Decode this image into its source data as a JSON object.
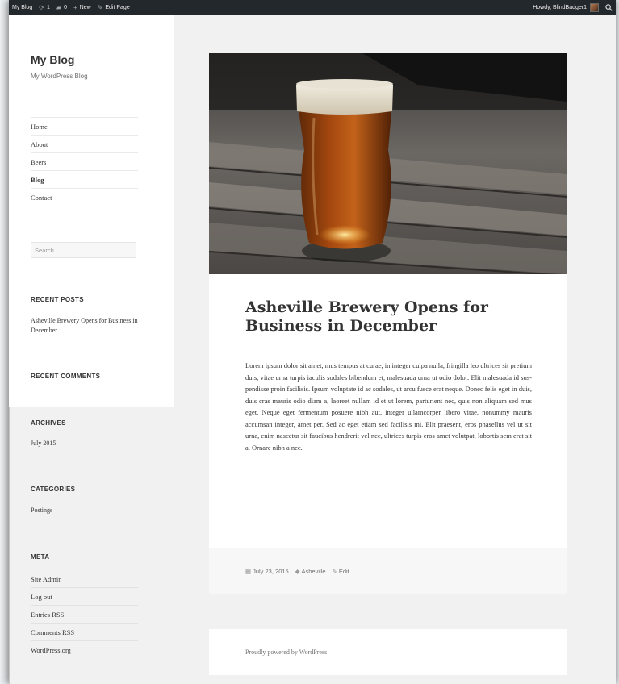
{
  "admin_bar": {
    "site_name": "My Blog",
    "updates_count": "1",
    "comments_count": "0",
    "new_label": "New",
    "edit_page_label": "Edit Page",
    "howdy": "Howdy, BlindBadger1"
  },
  "site": {
    "title": "My Blog",
    "description": "My WordPress Blog"
  },
  "nav": {
    "items": [
      {
        "label": "Home"
      },
      {
        "label": "About"
      },
      {
        "label": "Beers"
      },
      {
        "label": "Blog"
      },
      {
        "label": "Contact"
      }
    ],
    "current": "Blog"
  },
  "search": {
    "placeholder": "Search …"
  },
  "widgets": {
    "recent_posts": {
      "title": "RECENT POSTS",
      "items": [
        "Asheville Brewery Opens for Business in December"
      ]
    },
    "recent_comments": {
      "title": "RECENT COMMENTS"
    },
    "archives": {
      "title": "ARCHIVES",
      "items": [
        "July 2015"
      ]
    },
    "categories": {
      "title": "CATEGORIES",
      "items": [
        "Postings"
      ]
    },
    "meta": {
      "title": "META",
      "items": [
        "Site Admin",
        "Log out",
        "Entries RSS",
        "Comments RSS",
        "WordPress.org"
      ]
    }
  },
  "post": {
    "title": "Asheville Brewery Opens for Business in December",
    "body": "Lorem ipsum dolor sit amet, mus tempus at curae, in integer culpa nulla, fringilla leo ultrices sit pretium duis, vitae urna turpis iaculis sodales bibendum et, malesuada urna ut odio dolor. Elit malesuada id sus­pendisse proin facilisis. Ipsum voluptate id ac sodales, ut arcu fusce erat neque. Donec felis eget in duis, duis cras mauris odio diam a, laoreet nul­lam id et ut lorem, parturient nec, quis non aliquam sed mus eget. Neque eget fermentum posuere nibh aut, integer ullamcorper libero vitae, non­ummy mauris accumsan integer, amet per. Sed ac eget etiam sed facilisis mi. Elit praesent, eros phasellus vel ut sit urna, enim nascetur sit fau­cibus hendrerit vel nec, ultrices turpis eros amet volutpat, lobortis sem erat sit a. Ornare nibh a nec.",
    "date": "July 23, 2015",
    "category": "Asheville",
    "edit_label": "Edit"
  },
  "footer": {
    "text": "Proudly powered by WordPress"
  },
  "colors": {
    "admin_bar": "#23282d",
    "page_bg": "#f1f1f1",
    "text": "#333333",
    "muted": "#707070"
  },
  "icons": [
    "wordpress-logo-icon",
    "updates-icon",
    "comments-icon",
    "plus-icon",
    "pencil-icon",
    "avatar",
    "search-icon",
    "calendar-icon",
    "tag-icon",
    "edit-pencil-icon"
  ]
}
